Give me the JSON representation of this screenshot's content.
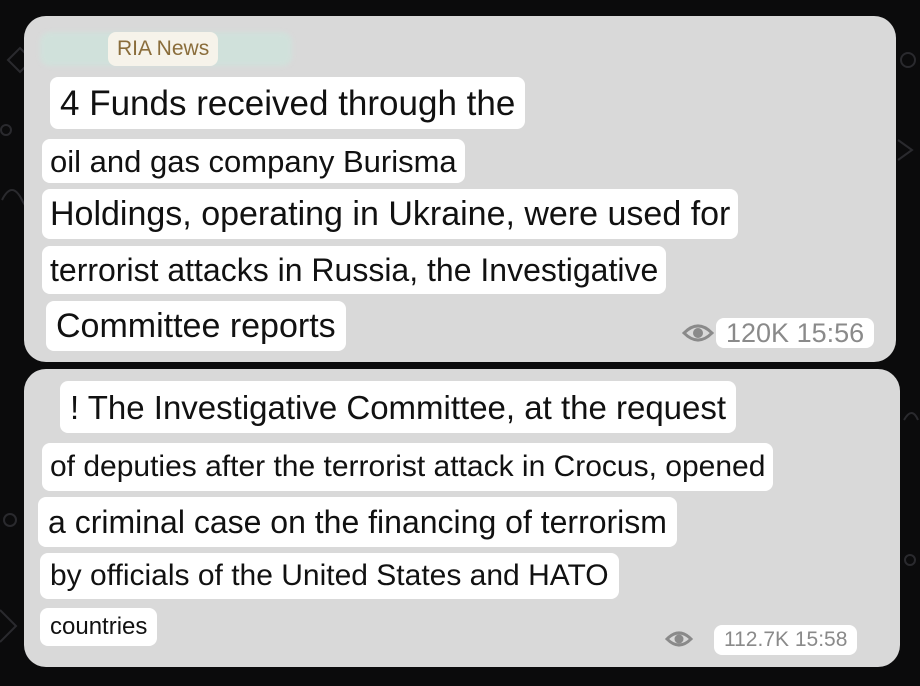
{
  "messages": [
    {
      "sender": "RIA News",
      "lines": [
        "4 Funds received through the",
        "oil and gas company Burisma",
        "Holdings, operating in Ukraine, were used for",
        "terrorist attacks in Russia, the Investigative",
        "Committee reports"
      ],
      "views": "120K",
      "time": "15:56"
    },
    {
      "lines": [
        "! The Investigative Committee, at the request",
        "of deputies after the terrorist attack in Crocus, opened",
        "a criminal case on the financing of terrorism",
        "by officials of the United States and HATO",
        "countries"
      ],
      "views": "112.7K",
      "time": "15:58"
    }
  ],
  "icons": {
    "views": "eye-icon"
  },
  "colors": {
    "background": "#0b0b0c",
    "bubble": "#d9d9d9",
    "text_highlight": "#ffffff",
    "sender_name": "#8a6d3b",
    "meta_text": "#8a8a8a"
  }
}
